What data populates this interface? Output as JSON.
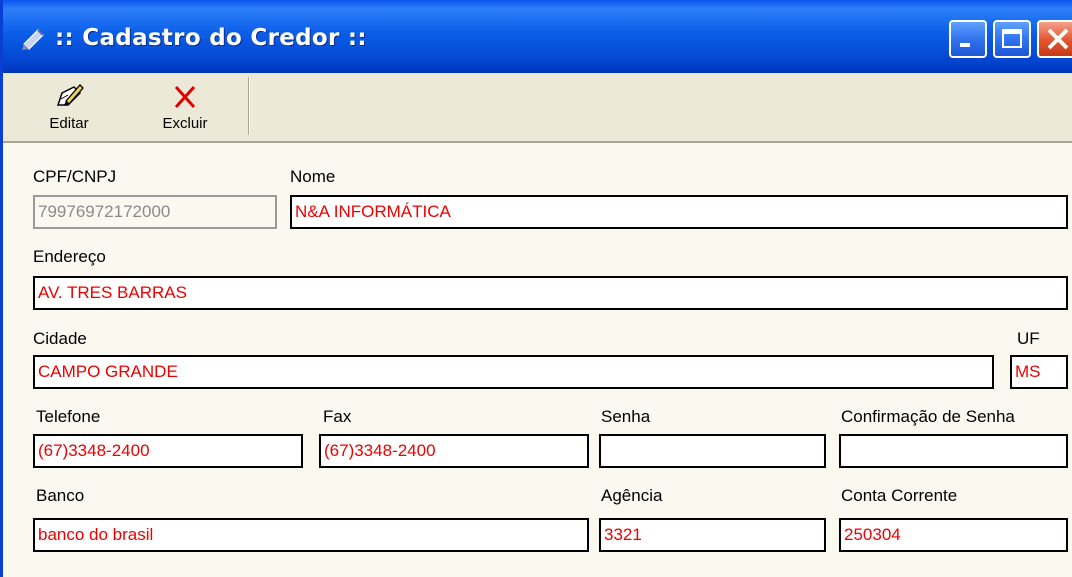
{
  "window": {
    "title": ":: Cadastro do Credor ::",
    "colors": {
      "titlebar": "#0a55ee",
      "close_button": "#e2542e",
      "field_text": "#ee0000",
      "disabled_text": "#8a8a8a"
    }
  },
  "toolbar": {
    "editar_label": "Editar",
    "excluir_label": "Excluir",
    "editar_icon": "edit-pencil-icon",
    "excluir_icon": "red-x-icon"
  },
  "form": {
    "cpf_cnpj": {
      "label": "CPF/CNPJ",
      "value": "79976972172000"
    },
    "nome": {
      "label": "Nome",
      "value": "N&A INFORMÁTICA"
    },
    "endereco": {
      "label": "Endereço",
      "value": "AV. TRES BARRAS"
    },
    "cidade": {
      "label": "Cidade",
      "value": "CAMPO GRANDE"
    },
    "uf": {
      "label": "UF",
      "value": "MS"
    },
    "telefone": {
      "label": "Telefone",
      "value": "(67)3348-2400"
    },
    "fax": {
      "label": "Fax",
      "value": "(67)3348-2400"
    },
    "senha": {
      "label": "Senha",
      "value": ""
    },
    "confirmacao_senha": {
      "label": "Confirmação de Senha",
      "value": ""
    },
    "banco": {
      "label": "Banco",
      "value": "banco do brasil"
    },
    "agencia": {
      "label": "Agência",
      "value": "3321"
    },
    "conta_corrente": {
      "label": "Conta Corrente",
      "value": "250304"
    }
  }
}
